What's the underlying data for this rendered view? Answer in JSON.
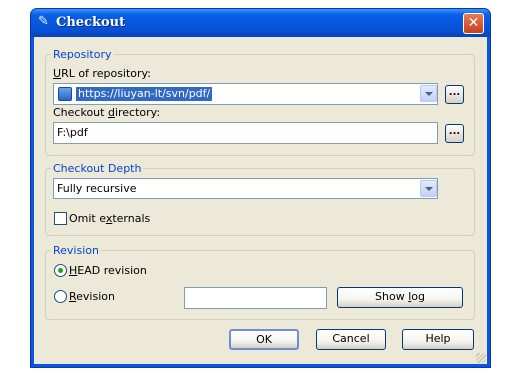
{
  "window": {
    "title": "Checkout",
    "close": "✕"
  },
  "repository": {
    "group_label": "Repository",
    "url_label_pre": "",
    "url_label_ul": "U",
    "url_label_post": "RL of repository:",
    "url_value": "https://liuyan-lt/svn/pdf/",
    "dir_label_pre": "Checkout ",
    "dir_label_ul": "d",
    "dir_label_post": "irectory:",
    "dir_value": "F:\\pdf",
    "browse_label": "..."
  },
  "depth": {
    "group_label": "Checkout Depth",
    "selected": "Fully recursive",
    "omit_pre": "Omit e",
    "omit_ul": "x",
    "omit_post": "ternals",
    "omit_checked": false
  },
  "revision": {
    "group_label": "Revision",
    "head_ul": "H",
    "head_post": "EAD revision",
    "head_selected": true,
    "rev_ul": "R",
    "rev_post": "evision",
    "rev_value": "",
    "showlog_pre": "Show ",
    "showlog_ul": "l",
    "showlog_post": "og"
  },
  "buttons": {
    "ok": "OK",
    "cancel": "Cancel",
    "help": "Help"
  },
  "colors": {
    "title_blue": "#0a5fe8",
    "group_label": "#0046d5",
    "dialog_bg": "#ece9d8"
  }
}
